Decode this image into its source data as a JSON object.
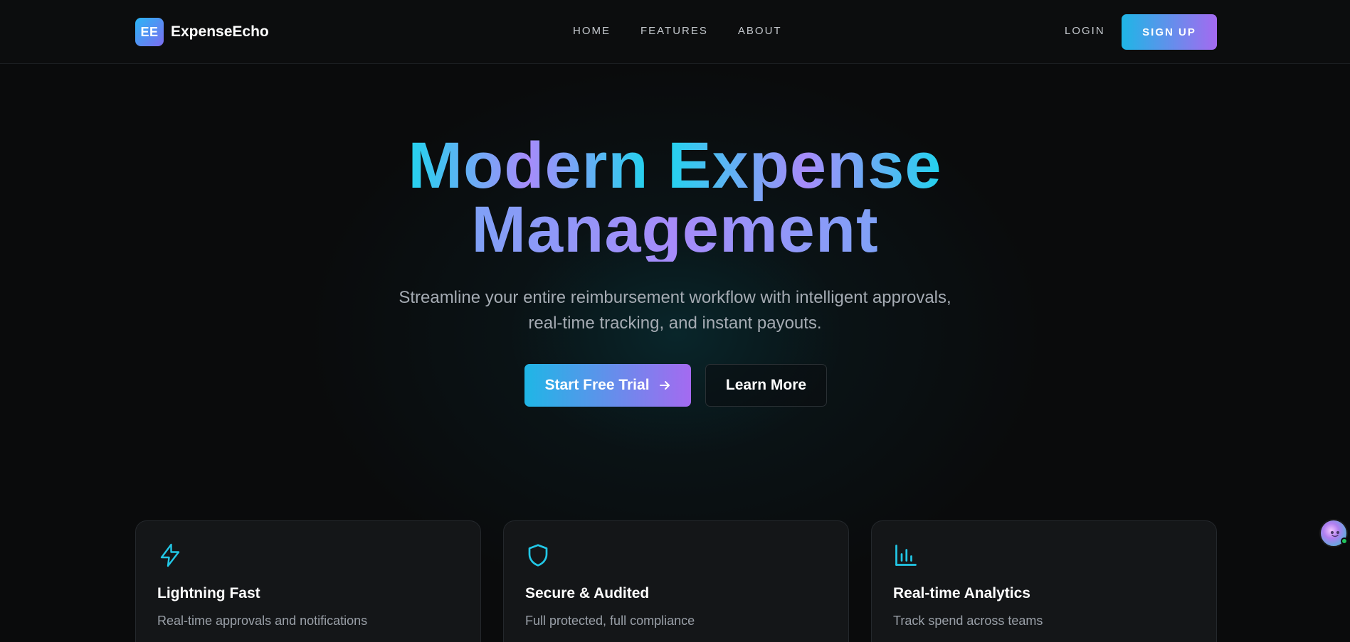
{
  "brand": {
    "logo_text": "EE",
    "name": "ExpenseEcho"
  },
  "nav": {
    "items": [
      {
        "label": "HOME"
      },
      {
        "label": "FEATURES"
      },
      {
        "label": "ABOUT"
      }
    ],
    "login_label": "LOGIN",
    "signup_label": "SIGN UP"
  },
  "hero": {
    "title_line1_part1": "Modern",
    "title_line1_part2": "Expense",
    "title_line2": "Management",
    "subtitle_line1": "Streamline your entire reimbursement workflow with intelligent approvals,",
    "subtitle_line2": "real-time tracking, and instant payouts.",
    "primary_cta": "Start Free Trial",
    "primary_cta_icon": "arrow-right-icon",
    "secondary_cta": "Learn More"
  },
  "features": [
    {
      "icon": "lightning-icon",
      "title": "Lightning Fast",
      "description": "Real-time approvals and notifications"
    },
    {
      "icon": "shield-icon",
      "title": "Secure & Audited",
      "description": "Full protected, full compliance"
    },
    {
      "icon": "bar-chart-icon",
      "title": "Real-time Analytics",
      "description": "Track spend across teams"
    }
  ],
  "colors": {
    "accent_cyan": "#22d3ee",
    "accent_purple": "#a78bfa",
    "background": "#0a0b0c",
    "card": "#141618",
    "status_online": "#22c55e"
  }
}
